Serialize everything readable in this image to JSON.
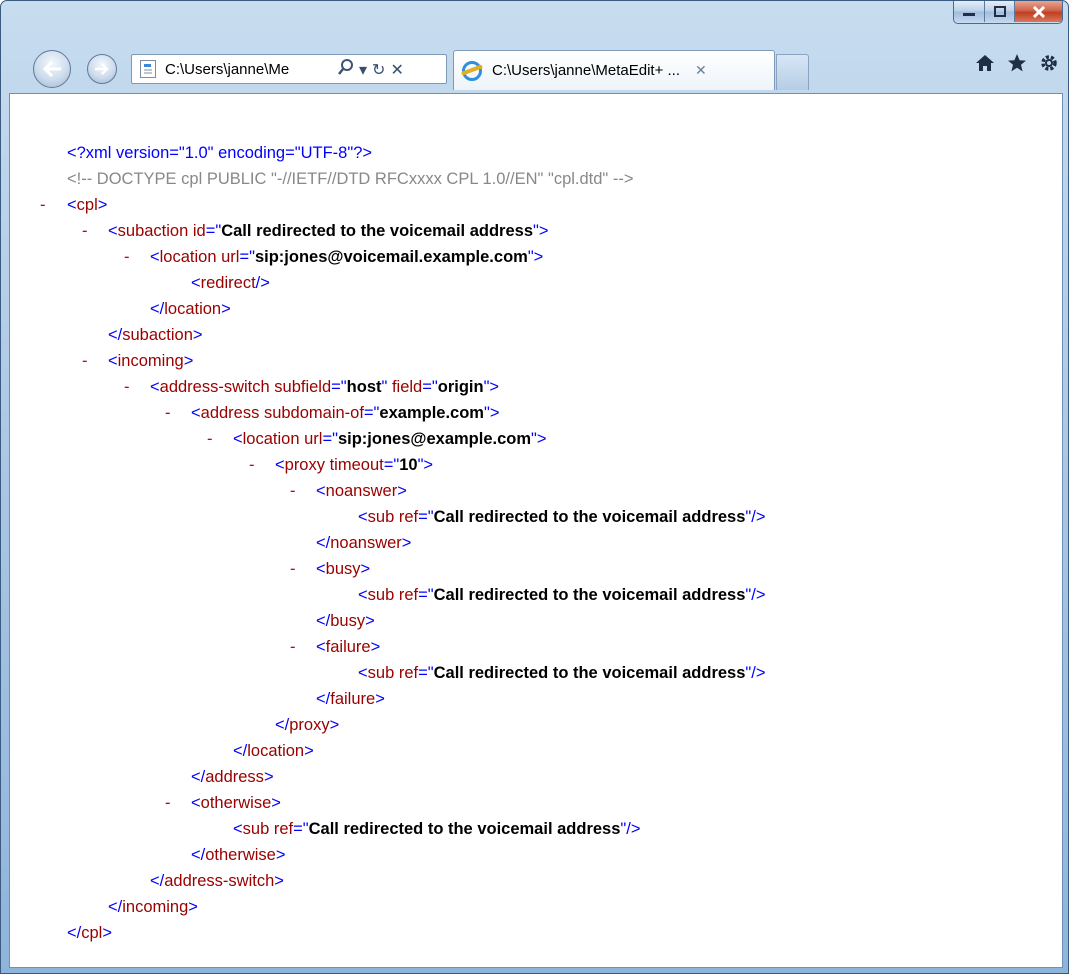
{
  "browser": {
    "address_url": "C:\\Users\\janne\\Me",
    "search_icon": "magnifier-icon",
    "dropdown_glyph": "▾",
    "refresh_glyph": "↻",
    "stop_glyph": "✕",
    "tab_title": "C:\\Users\\janne\\MetaEdit+ ...",
    "tab_close": "✕",
    "toolbar_icons": [
      "home-icon",
      "favorites-star-icon",
      "tools-gear-icon"
    ]
  },
  "xml": {
    "pi": "<?xml version=\"1.0\" encoding=\"UTF-8\"?>",
    "comment": "<!-- DOCTYPE cpl PUBLIC \"-//IETF//DTD RFCxxxx CPL 1.0//EN\" \"cpl.dtd\" -->",
    "tags": {
      "cpl": "cpl",
      "subaction": "subaction",
      "location": "location",
      "redirect": "redirect",
      "incoming": "incoming",
      "address_switch": "address-switch",
      "address": "address",
      "proxy": "proxy",
      "noanswer": "noanswer",
      "busy": "busy",
      "failure": "failure",
      "sub": "sub",
      "otherwise": "otherwise"
    },
    "attrs": {
      "id": "id",
      "url": "url",
      "subfield": "subfield",
      "field": "field",
      "subdomain_of": "subdomain-of",
      "timeout": "timeout",
      "ref": "ref"
    },
    "values": {
      "subaction_id": "Call redirected to the voicemail address",
      "voicemail_url": "sip:jones@voicemail.example.com",
      "subfield": "host",
      "field": "origin",
      "subdomain": "example.com",
      "location_url": "sip:jones@example.com",
      "timeout": "10",
      "sub_ref": "Call redirected to the voicemail address"
    }
  }
}
